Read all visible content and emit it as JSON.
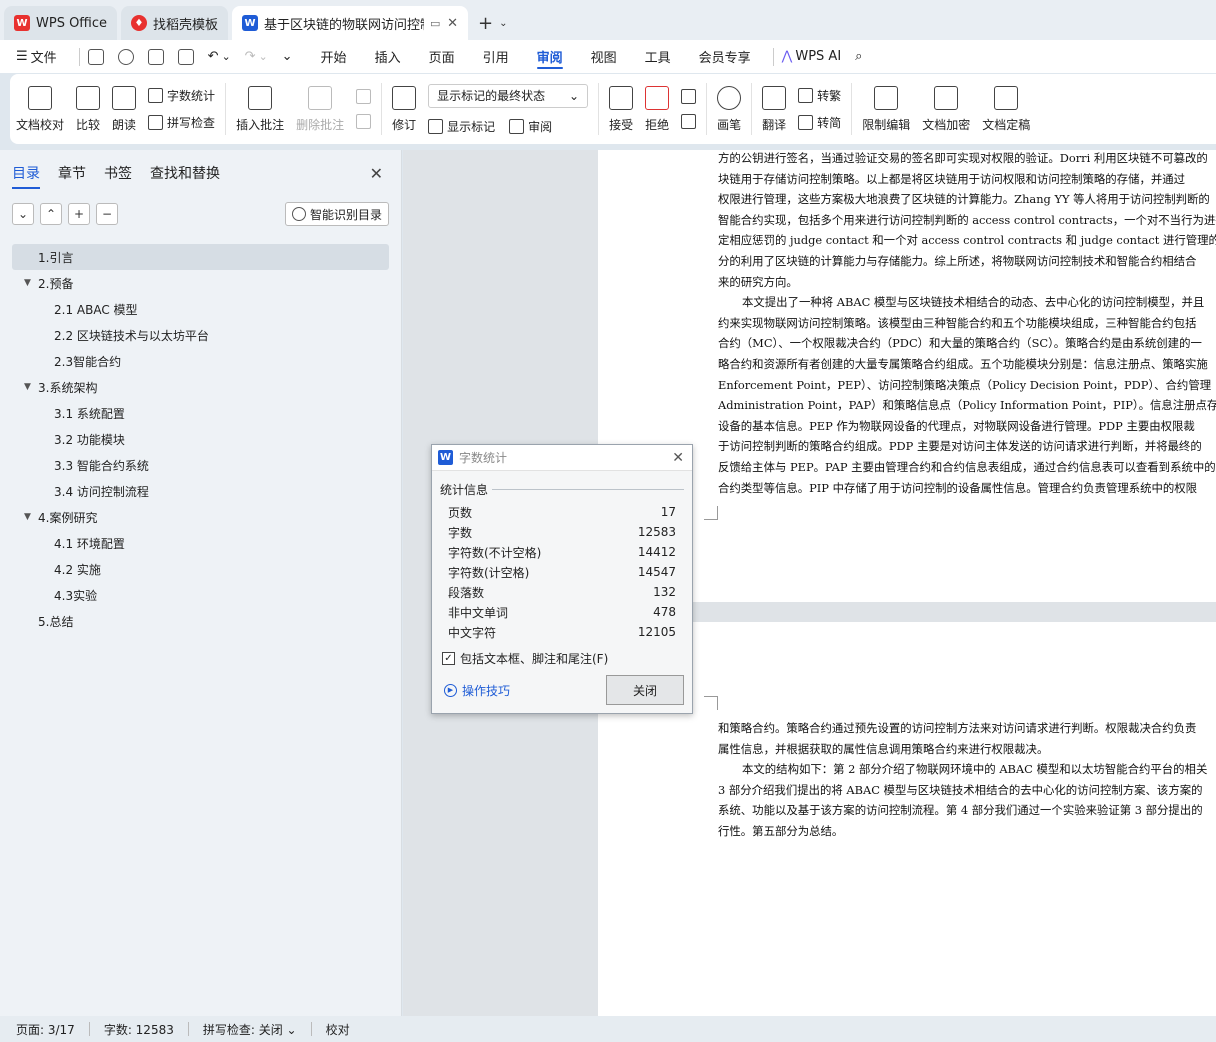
{
  "tabs": {
    "wps": "WPS Office",
    "template": "找稻壳模板",
    "doc": "基于区块链的物联网访问控制..."
  },
  "menu": {
    "file": "文件",
    "items": [
      "开始",
      "插入",
      "页面",
      "引用",
      "审阅",
      "视图",
      "工具",
      "会员专享"
    ],
    "ai": "WPS AI"
  },
  "ribbon": {
    "proofread": "文档校对",
    "compare": "比较",
    "read": "朗读",
    "wordcount": "字数统计",
    "spellcheck": "拼写检查",
    "insert_comment": "插入批注",
    "delete_comment": "删除批注",
    "revise": "修订",
    "markup_state": "显示标记的最终状态",
    "show_markup": "显示标记",
    "review": "审阅",
    "accept": "接受",
    "reject": "拒绝",
    "pen": "画笔",
    "translate": "翻译",
    "to_trad": "转繁",
    "to_simp": "转简",
    "restrict": "限制编辑",
    "encrypt": "文档加密",
    "finalize": "文档定稿"
  },
  "sidebar": {
    "tabs": [
      "目录",
      "章节",
      "书签",
      "查找和替换"
    ],
    "smart": "智能识别目录",
    "toc": [
      {
        "label": "1.引言",
        "level": 1,
        "has": false
      },
      {
        "label": "2.预备",
        "level": 1,
        "has": true
      },
      {
        "label": "2.1 ABAC 模型",
        "level": 2
      },
      {
        "label": "2.2  区块链技术与以太坊平台",
        "level": 2
      },
      {
        "label": "2.3智能合约",
        "level": 2
      },
      {
        "label": "3.系统架构",
        "level": 1,
        "has": true
      },
      {
        "label": "3.1  系统配置",
        "level": 2
      },
      {
        "label": "3.2  功能模块",
        "level": 2
      },
      {
        "label": "3.3  智能合约系统",
        "level": 2
      },
      {
        "label": "3.4  访问控制流程",
        "level": 2
      },
      {
        "label": "4.案例研究",
        "level": 1,
        "has": true
      },
      {
        "label": "4.1 环境配置",
        "level": 2
      },
      {
        "label": "4.2  实施",
        "level": 2
      },
      {
        "label": "4.3实验",
        "level": 2
      },
      {
        "label": "5.总结",
        "level": 1,
        "has": false
      }
    ]
  },
  "page1": [
    {
      "t": "方的公钥进行签名，当通过验证交易的签名即可实现对权限的验证。Dorri 利用区块链不可篡改的",
      "i": false
    },
    {
      "t": "块链用于存储访问控制策略。以上都是将区块链用于访问权限和访问控制策略的存储，并通过",
      "i": false
    },
    {
      "t": "权限进行管理，这些方案极大地浪费了区块链的计算能力。Zhang YY 等人将用于访问控制判断的",
      "i": false
    },
    {
      "t": "智能合约实现，包括多个用来进行访问控制判断的 access control contracts，一个对不当行为进行",
      "i": false
    },
    {
      "t": "定相应惩罚的 judge contact 和一个对 access control contracts 和 judge contact 进行管理的 register",
      "i": false
    },
    {
      "t": "分的利用了区块链的计算能力与存储能力。综上所述，将物联网访问控制技术和智能合约相结合",
      "i": false
    },
    {
      "t": "来的研究方向。",
      "i": false
    },
    {
      "t": "本文提出了一种将 ABAC 模型与区块链技术相结合的动态、去中心化的访问控制模型，并且",
      "i": true
    },
    {
      "t": "约来实现物联网访问控制策略。该模型由三种智能合约和五个功能模块组成，三种智能合约包括",
      "i": false
    },
    {
      "t": "合约（MC）、一个权限裁决合约（PDC）和大量的策略合约（SC）。策略合约是由系统创建的一",
      "i": false
    },
    {
      "t": "略合约和资源所有者创建的大量专属策略合约组成。五个功能模块分别是：信息注册点、策略实施",
      "i": false
    },
    {
      "t": "Enforcement Point，PEP）、访问控制策略决策点（Policy Decision Point，PDP）、合约管理",
      "i": false
    },
    {
      "t": "Administration Point，PAP）和策略信息点（Policy Information Point，PIP）。信息注册点存储了系",
      "i": false
    },
    {
      "t": "设备的基本信息。PEP 作为物联网设备的代理点，对物联网设备进行管理。PDP 主要由权限裁",
      "i": false
    },
    {
      "t": "于访问控制判断的策略合约组成。PDP 主要是对访问主体发送的访问请求进行判断，并将最终的",
      "i": false
    },
    {
      "t": "反馈给主体与 PEP。PAP 主要由管理合约和合约信息表组成，通过合约信息表可以查看到系统中的",
      "i": false
    },
    {
      "t": "合约类型等信息。PIP 中存储了用于访问控制的设备属性信息。管理合约负责管理系统中的权限",
      "i": false
    }
  ],
  "page2": [
    {
      "t": "和策略合约。策略合约通过预先设置的访问控制方法来对访问请求进行判断。权限裁决合约负责",
      "i": false
    },
    {
      "t": "属性信息，并根据获取的属性信息调用策略合约来进行权限裁决。",
      "i": false
    },
    {
      "t": "本文的结构如下：第 2 部分介绍了物联网环境中的 ABAC 模型和以太坊智能合约平台的相关",
      "i": true
    },
    {
      "t": "3 部分介绍我们提出的将 ABAC 模型与区块链技术相结合的去中心化的访问控制方案、该方案的",
      "i": false
    },
    {
      "t": "系统、功能以及基于该方案的访问控制流程。第 4 部分我们通过一个实验来验证第 3 部分提出的",
      "i": false
    },
    {
      "t": "行性。第五部分为总结。",
      "i": false
    }
  ],
  "dialog": {
    "title": "字数统计",
    "group": "统计信息",
    "rows": [
      {
        "k": "页数",
        "v": "17"
      },
      {
        "k": "字数",
        "v": "12583"
      },
      {
        "k": "字符数(不计空格)",
        "v": "14412"
      },
      {
        "k": "字符数(计空格)",
        "v": "14547"
      },
      {
        "k": "段落数",
        "v": "132"
      },
      {
        "k": "非中文单词",
        "v": "478"
      },
      {
        "k": "中文字符",
        "v": "12105"
      }
    ],
    "include": "包括文本框、脚注和尾注(F)",
    "tips": "操作技巧",
    "close": "关闭"
  },
  "status": {
    "page": "页面: 3/17",
    "words": "字数: 12583",
    "spell": "拼写检查: 关闭",
    "proof": "校对"
  }
}
